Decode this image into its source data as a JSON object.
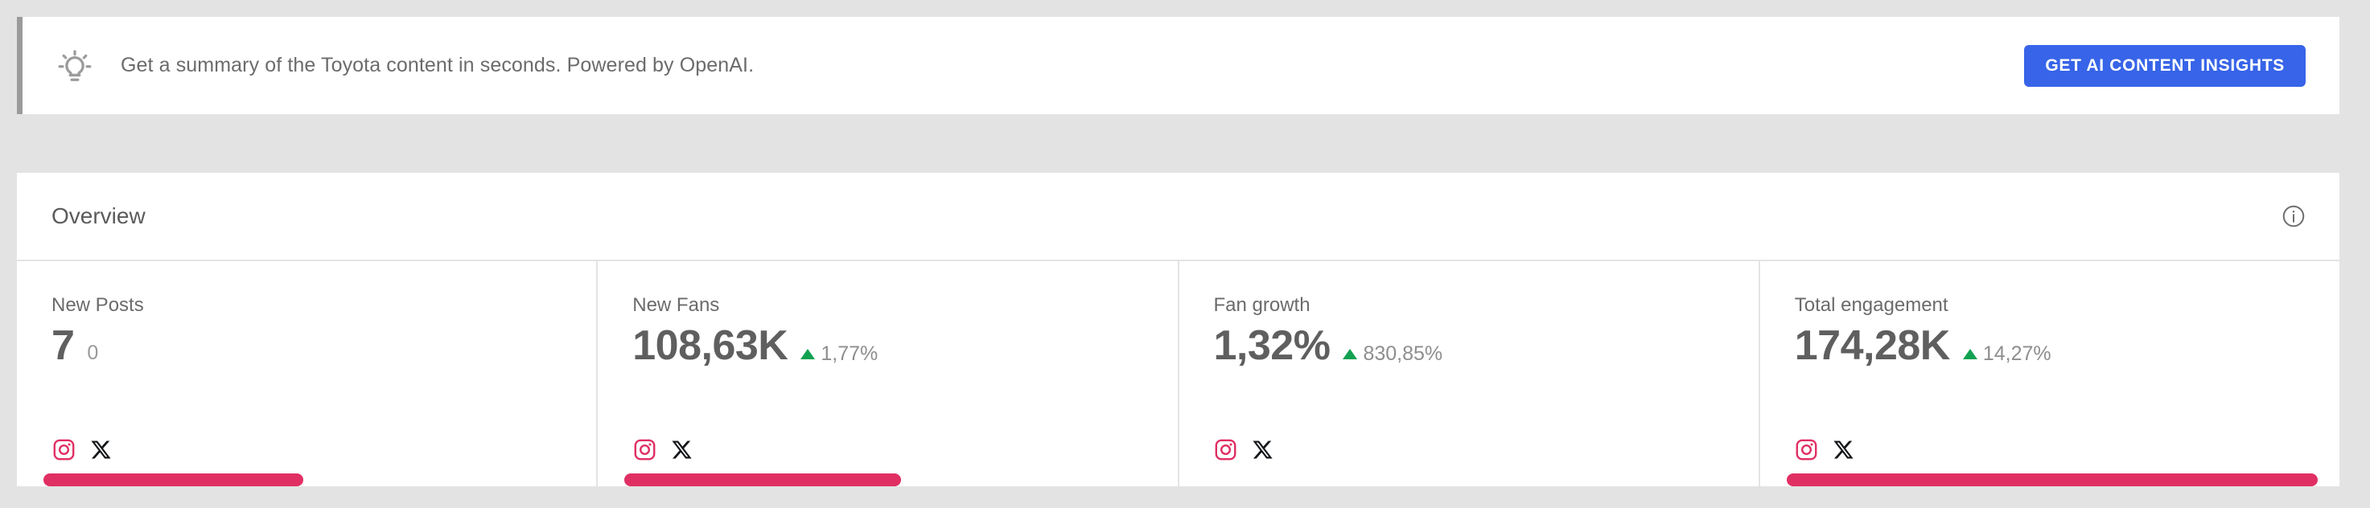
{
  "banner": {
    "icon": "lightbulb-icon",
    "text": "Get a summary of the Toyota content in seconds. Powered by OpenAI.",
    "cta_label": "GET AI CONTENT INSIGHTS",
    "cta_color": "#3764e8",
    "accent_color": "#9b9b9b"
  },
  "overview": {
    "title": "Overview",
    "info_icon": "info-circle-icon",
    "accent_pink": "#e02f63",
    "positive_color": "#12a150",
    "tiles": [
      {
        "label": "New Posts",
        "value": "7",
        "secondary": "0",
        "delta": null,
        "delta_direction": null,
        "channels": [
          "instagram-icon",
          "x-icon"
        ],
        "bar_percent": 47
      },
      {
        "label": "New Fans",
        "value": "108,63K",
        "secondary": null,
        "delta": "1,77%",
        "delta_direction": "up",
        "channels": [
          "instagram-icon",
          "x-icon"
        ],
        "bar_percent": 50
      },
      {
        "label": "Fan growth",
        "value": "1,32%",
        "secondary": null,
        "delta": "830,85%",
        "delta_direction": "up",
        "channels": [
          "instagram-icon",
          "x-icon"
        ],
        "bar_percent": 0
      },
      {
        "label": "Total engagement",
        "value": "174,28K",
        "secondary": null,
        "delta": "14,27%",
        "delta_direction": "up",
        "channels": [
          "instagram-icon",
          "x-icon"
        ],
        "bar_percent": 96
      }
    ]
  }
}
